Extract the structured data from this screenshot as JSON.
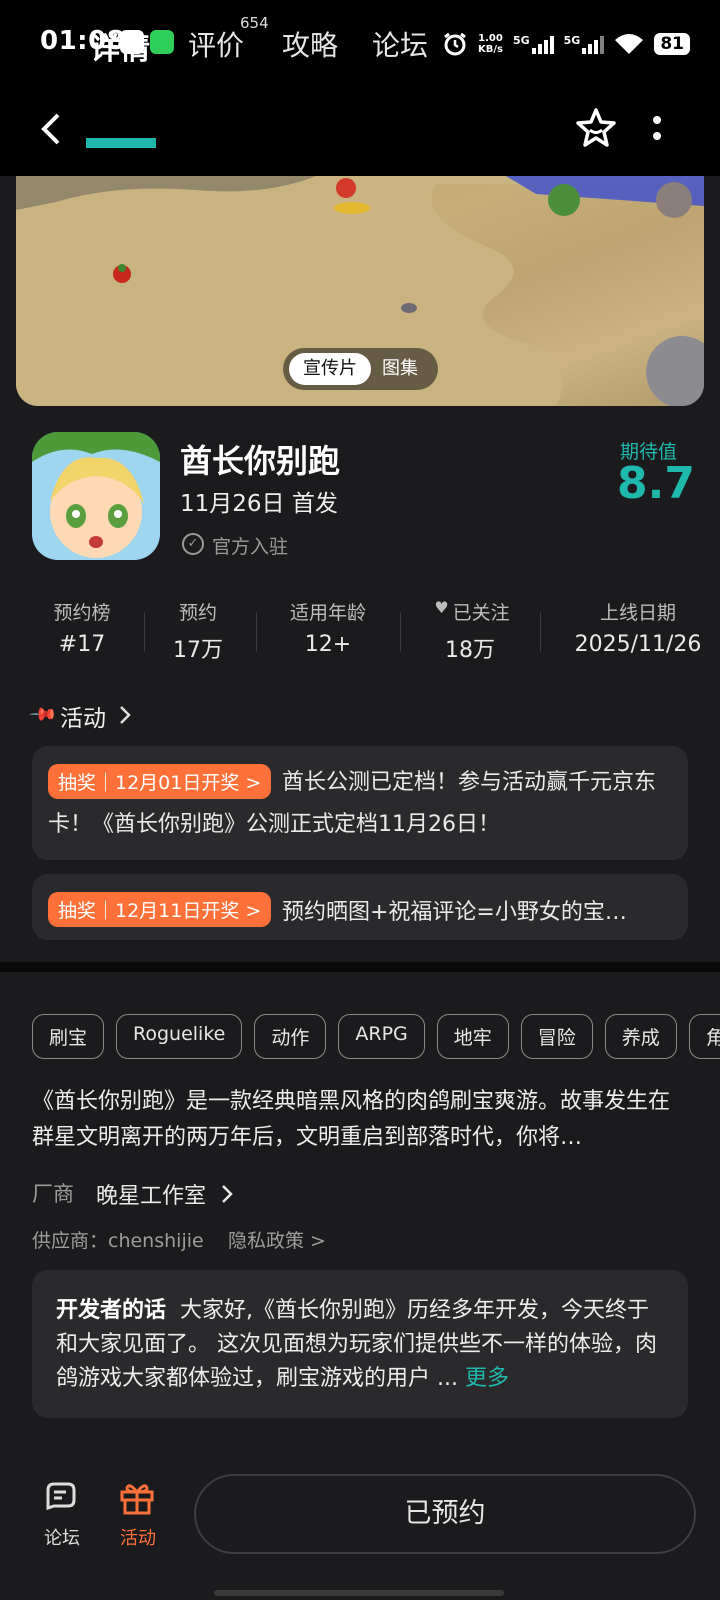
{
  "status_bar": {
    "time": "01:08",
    "speed_value": "1.00",
    "speed_unit": "KB/s",
    "sim1": "5G",
    "sim2": "5G",
    "battery": "81",
    "icons": [
      "qq-icon",
      "wechat-icon",
      "alarm-icon",
      "signal-icon",
      "wifi-icon",
      "battery-icon"
    ]
  },
  "nav": {
    "back_icon": "chevron-left-icon",
    "tabs": [
      "详情",
      "评价",
      "攻略",
      "论坛"
    ],
    "review_count": "654",
    "actions": [
      "star-icon",
      "more-vertical-icon"
    ]
  },
  "media": {
    "segments": [
      "宣传片",
      "图集"
    ],
    "selected": "宣传片"
  },
  "app": {
    "name": "酋长你别跑",
    "release": "11月26日 首发",
    "official": "官方入驻",
    "expect_label": "期待值",
    "expect_value": "8.7"
  },
  "stats": [
    {
      "label": "预约榜",
      "value": "#17"
    },
    {
      "label": "预约",
      "value": "17万"
    },
    {
      "label": "适用年龄",
      "value": "12+"
    },
    {
      "label": "已关注",
      "value": "18万"
    },
    {
      "label": "上线日期",
      "value": "2025/11/26"
    }
  ],
  "activity": {
    "title": "活动",
    "items": [
      {
        "tag": "抽奖｜12月01日开奖 >",
        "text": "酋长公测已定档！参与活动赢千元京东卡！《酋长你别跑》公测正式定档11月26日！"
      },
      {
        "tag": "抽奖｜12月11日开奖 >",
        "text": "预约晒图+祝福评论=小野女的宝…"
      }
    ]
  },
  "tags": [
    "刷宝",
    "Roguelike",
    "动作",
    "ARPG",
    "地牢",
    "冒险",
    "养成",
    "角"
  ],
  "description": "《酋长你别跑》是一款经典暗黑风格的肉鸽刷宝爽游。故事发生在群星文明离开的两万年后，文明重启到部落时代，你将…",
  "vendor": {
    "label": "厂商",
    "name": "晚星工作室"
  },
  "supplier": "供应商：chenshijie",
  "privacy": "隐私政策 >",
  "developer": {
    "label": "开发者的话",
    "text": "大家好,《酋长你别跑》历经多年开发，今天终于和大家见面了。 这次见面想为玩家们提供些不一样的体验，肉鸽游戏大家都体验过，刷宝游戏的用户 ...",
    "more": "更多"
  },
  "bottom": {
    "forum": "论坛",
    "activity": "活动",
    "reserve": "已预约"
  },
  "colors": {
    "accent": "#1fb8ad",
    "orange": "#ff7139",
    "background": "#1b1b1d"
  }
}
